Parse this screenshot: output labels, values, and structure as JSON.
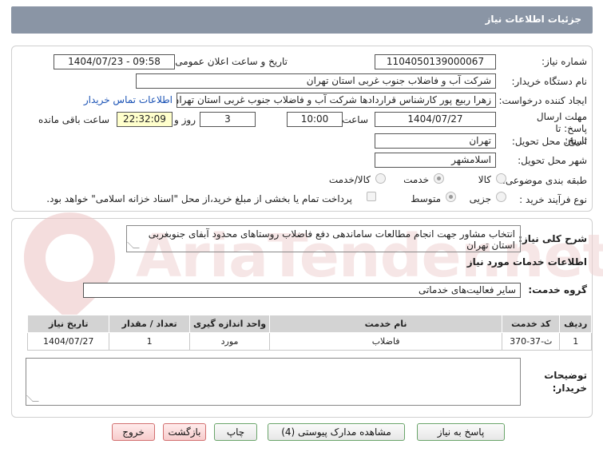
{
  "header": {
    "title": "جزئیات اطلاعات نیاز"
  },
  "fields": {
    "need_number_label": "شماره نیاز:",
    "need_number": "1104050139000067",
    "announce_label": "تاریخ و ساعت اعلان عمومی:",
    "announce_value": "1404/07/23 - 09:58",
    "buyer_org_label": "نام دستگاه خریدار:",
    "buyer_org": "شرکت آب و فاضلاب جنوب غربی استان تهران",
    "requester_label": "ایجاد کننده درخواست:",
    "requester": "زهرا  ربیع پور کارشناس قراردادها  شرکت آب و فاضلاب جنوب غربی استان تهران",
    "contact_link": "اطلاعات تماس خریدار",
    "deadline_label": "مهلت ارسال پاسخ: تا تاریخ:",
    "deadline_date": "1404/07/27",
    "time_label": "ساعت",
    "deadline_time": "10:00",
    "days_label": "روز و",
    "days": "3",
    "remaining_time": "22:32:09",
    "remaining_label": "ساعت باقی مانده",
    "province_label": "استان محل تحویل:",
    "province": "تهران",
    "city_label": "شهر محل تحویل:",
    "city": "اسلامشهر",
    "category_label": "طبقه بندی موضوعی:",
    "category_options": [
      "کالا",
      "خدمت",
      "کالا/خدمت"
    ],
    "category_selected": "خدمت",
    "process_label": "نوع فرآیند خرید :",
    "process_options": [
      "جزیی",
      "متوسط"
    ],
    "process_selected": "متوسط",
    "treasury_note": "پرداخت تمام یا بخشی از مبلغ خرید،از محل \"اسناد خزانه اسلامی\" خواهد بود."
  },
  "description": {
    "label": "شرح کلی نیاز:",
    "value": "انتخاب مشاور جهت انجام مطالعات ساماندهی دفع فاضلاب روستاهای محدود آبفای جنوبغربی استان تهران"
  },
  "services": {
    "section_title": "اطلاعات خدمات مورد نیاز",
    "group_label": "گروه خدمت:",
    "group_value": "سایر فعالیت‌های خدماتی",
    "columns": [
      "ردیف",
      "کد خدمت",
      "نام خدمت",
      "واحد اندازه گیری",
      "تعداد / مقدار",
      "تاریخ نیاز"
    ],
    "rows": [
      [
        "1",
        "ث-37-370",
        "فاضلاب",
        "مورد",
        "1",
        "1404/07/27"
      ]
    ]
  },
  "buyer_notes": {
    "label": "توضیحات خریدار:",
    "value": ""
  },
  "buttons": {
    "reply": "پاسخ به نیاز",
    "attachments": "مشاهده مدارک پیوستی (4)",
    "print": "چاپ",
    "back": "بازگشت",
    "exit": "خروج"
  },
  "watermark": "AriaTender.net",
  "colors": {
    "header_bg": "#8a95a5",
    "highlight": "#ffffcc",
    "link": "#1a52b5",
    "table_header": "#d3d3d3"
  }
}
